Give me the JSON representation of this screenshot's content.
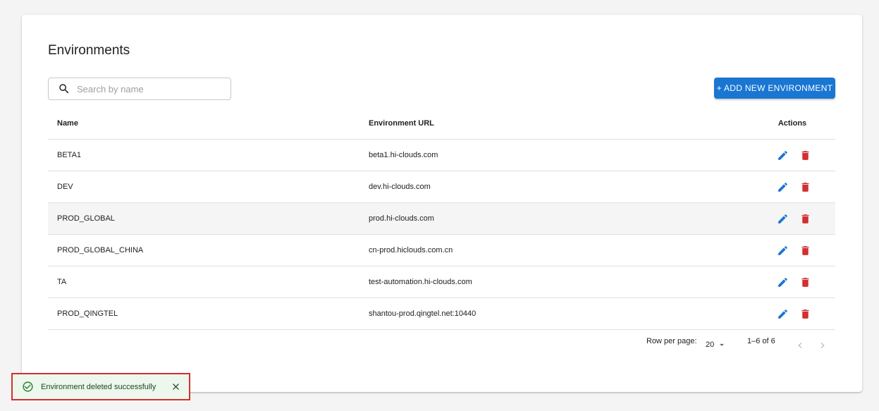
{
  "page": {
    "title": "Environments"
  },
  "search": {
    "placeholder": "Search by name",
    "value": ""
  },
  "toolbar": {
    "add_label": "+ ADD NEW ENVIRONMENT"
  },
  "table": {
    "headers": {
      "name": "Name",
      "url": "Environment URL",
      "actions": "Actions"
    },
    "rows": [
      {
        "name": "BETA1",
        "url": "beta1.hi-clouds.com"
      },
      {
        "name": "DEV",
        "url": "dev.hi-clouds.com"
      },
      {
        "name": "PROD_GLOBAL",
        "url": "prod.hi-clouds.com"
      },
      {
        "name": "PROD_GLOBAL_CHINA",
        "url": "cn-prod.hiclouds.com.cn"
      },
      {
        "name": "TA",
        "url": "test-automation.hi-clouds.com"
      },
      {
        "name": "PROD_QINGTEL",
        "url": "shantou-prod.qingtel.net:10440"
      }
    ]
  },
  "pagination": {
    "rows_per_page_label": "Row per page:",
    "rows_per_page_value": "20",
    "range": "1–6 of 6"
  },
  "snackbar": {
    "message": "Environment deleted successfully"
  },
  "colors": {
    "primary": "#1976d2",
    "danger": "#d32f2f",
    "success": "#2e7d32",
    "success_bg": "#edf7ed"
  },
  "icons": {
    "search": "search-icon",
    "edit": "pencil-icon",
    "delete": "trash-icon",
    "dropdown": "caret-down-icon",
    "prev": "chevron-left-icon",
    "next": "chevron-right-icon",
    "success": "check-circle-icon",
    "close": "close-icon"
  }
}
